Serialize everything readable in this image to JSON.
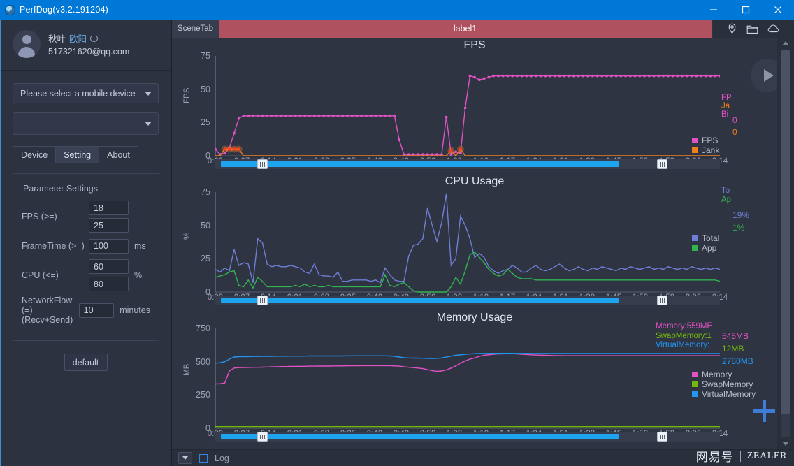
{
  "window": {
    "title": "PerfDog(v3.2.191204)",
    "app_icon": "globe-icon",
    "minimize": "minimize-icon",
    "maximize": "maximize-icon",
    "close": "close-icon"
  },
  "sidebar": {
    "profile": {
      "name_part1": "秋叶",
      "name_part2": "欧阳",
      "power_icon": "power-icon",
      "email": "517321620@qq.com"
    },
    "device_select": {
      "value": "Please select a mobile device",
      "caret": "chevron-down-icon"
    },
    "process_select": {
      "value": "",
      "caret": "chevron-down-icon"
    },
    "tabs": [
      {
        "label": "Device",
        "active": false
      },
      {
        "label": "Setting",
        "active": true
      },
      {
        "label": "About",
        "active": false
      }
    ],
    "settings": {
      "title": "Parameter Settings",
      "rows": [
        {
          "label": "FPS (>=)",
          "values": [
            "18",
            "25"
          ],
          "unit": ""
        },
        {
          "label": "FrameTime (>=)",
          "values": [
            "100"
          ],
          "unit": "ms"
        },
        {
          "label": "CPU (<=)",
          "values": [
            "60",
            "80"
          ],
          "unit": "%"
        },
        {
          "label": "NetworkFlow (=)\n(Recv+Send)",
          "values": [
            "10"
          ],
          "unit": "minutes"
        }
      ],
      "default_button": "default"
    }
  },
  "main": {
    "scene_tab": "SceneTab",
    "label_bar": "label1",
    "top_icons": [
      "location-pin-icon",
      "folder-icon",
      "cloud-icon"
    ],
    "play_button": "play-icon",
    "add_button": "plus-icon",
    "bottom": {
      "dropdown": "chevron-down-icon",
      "log_checkbox_label": "Log",
      "log_checked": false,
      "watermark_cn": "网易号",
      "watermark_en": "ZEALER"
    },
    "slider": {
      "left_handle": "range-handle-left",
      "right_handle": "range-handle-right"
    }
  },
  "chart_data": [
    {
      "type": "line",
      "title": "FPS",
      "ylabel": "FPS",
      "xlabel": "",
      "ylim": [
        0,
        75
      ],
      "yticks": [
        0,
        25,
        50,
        75
      ],
      "grid": false,
      "legend_position": "right",
      "x": [
        "0:00",
        "0:07",
        "0:14",
        "0:21",
        "0:28",
        "0:35",
        "0:42",
        "0:49",
        "0:56",
        "1:03",
        "1:10",
        "1:17",
        "1:24",
        "1:31",
        "1:38",
        "1:45",
        "1:52",
        "1:59",
        "2:06",
        "2:14"
      ],
      "cursor_labels": [
        "FP",
        "Ja",
        "Bi"
      ],
      "cursor_values": [
        "0",
        "0"
      ],
      "series": [
        {
          "name": "FPS",
          "color": "#e252c4",
          "values": [
            5,
            1,
            2,
            6,
            17,
            28,
            30,
            30,
            30,
            30,
            30,
            30,
            30,
            30,
            30,
            30,
            30,
            30,
            30,
            30,
            30,
            30,
            30,
            30,
            30,
            30,
            30,
            30,
            30,
            30,
            30,
            30,
            30,
            30,
            30,
            30,
            30,
            30,
            30,
            12,
            1,
            1,
            1,
            1,
            1,
            1,
            1,
            1,
            1,
            29,
            1,
            3,
            2,
            36,
            60,
            59,
            57,
            58,
            59,
            60,
            60,
            60,
            60,
            60,
            60,
            60,
            60,
            60,
            60,
            60,
            60,
            60,
            60,
            60,
            60,
            60,
            60,
            60,
            60,
            60,
            60,
            60,
            60,
            60,
            60,
            60,
            60,
            60,
            60,
            60,
            60,
            60,
            60,
            60,
            60,
            60,
            60,
            60,
            60,
            60,
            60,
            60,
            60,
            60,
            60,
            60,
            60,
            60
          ]
        },
        {
          "name": "Jank",
          "color": "#f07f1e",
          "values": [
            0,
            0,
            5,
            5,
            5,
            5,
            0,
            0,
            0,
            0,
            0,
            0,
            0,
            0,
            0,
            0,
            0,
            0,
            0,
            0,
            0,
            0,
            0,
            0,
            0,
            0,
            0,
            0,
            0,
            0,
            0,
            0,
            0,
            0,
            0,
            0,
            0,
            0,
            0,
            0,
            0,
            0,
            0,
            0,
            0,
            0,
            0,
            0,
            0,
            0,
            4,
            0,
            5,
            0,
            0,
            0,
            0,
            0,
            0,
            0,
            0,
            0,
            0,
            0,
            0,
            0,
            0,
            0,
            0,
            0,
            0,
            0,
            0,
            0,
            0,
            0,
            0,
            0,
            0,
            0,
            0,
            0,
            0,
            0,
            0,
            0,
            0,
            0,
            0,
            0,
            0,
            0,
            0,
            0,
            0,
            0,
            0,
            0,
            0,
            0,
            0,
            0,
            0,
            0,
            0,
            0,
            0,
            0
          ]
        }
      ],
      "legend": [
        {
          "label": "FPS",
          "color": "#e252c4"
        },
        {
          "label": "Jank",
          "color": "#f07f1e"
        }
      ]
    },
    {
      "type": "line",
      "title": "CPU Usage",
      "ylabel": "%",
      "xlabel": "",
      "ylim": [
        0,
        75
      ],
      "yticks": [
        0,
        25,
        50,
        75
      ],
      "grid": false,
      "legend_position": "right",
      "x": [
        "0:00",
        "0:07",
        "0:14",
        "0:21",
        "0:28",
        "0:35",
        "0:42",
        "0:49",
        "0:56",
        "1:03",
        "1:10",
        "1:17",
        "1:24",
        "1:31",
        "1:38",
        "1:45",
        "1:52",
        "1:59",
        "2:06",
        "2:14"
      ],
      "cursor_labels": [
        "To",
        "Ap"
      ],
      "cursor_values": [
        "19%",
        "1%"
      ],
      "series": [
        {
          "name": "Total",
          "color": "#6f7fd6",
          "values": [
            17,
            15,
            18,
            16,
            32,
            20,
            22,
            21,
            7,
            40,
            37,
            21,
            19,
            20,
            19,
            19,
            20,
            19,
            18,
            15,
            14,
            21,
            13,
            12,
            12,
            11,
            15,
            8,
            8,
            9,
            9,
            9,
            9,
            8,
            9,
            7,
            18,
            13,
            9,
            8,
            8,
            27,
            35,
            36,
            40,
            63,
            50,
            38,
            52,
            74,
            20,
            25,
            57,
            50,
            40,
            26,
            29,
            26,
            19,
            16,
            14,
            16,
            17,
            20,
            18,
            15,
            15,
            18,
            20,
            17,
            16,
            17,
            19,
            21,
            18,
            16,
            17,
            19,
            17,
            16,
            18,
            17,
            19,
            18,
            17,
            16,
            18,
            17,
            19,
            18,
            17,
            18,
            19,
            17,
            18,
            17,
            19,
            18,
            17,
            18,
            17,
            19,
            18,
            17,
            18,
            17,
            18,
            17
          ]
        },
        {
          "name": "App",
          "color": "#31b34f",
          "values": [
            11,
            12,
            13,
            15,
            16,
            5,
            4,
            9,
            3,
            11,
            8,
            4,
            4,
            4,
            4,
            4,
            4,
            5,
            4,
            6,
            4,
            5,
            4,
            4,
            5,
            4,
            4,
            4,
            4,
            4,
            4,
            4,
            4,
            4,
            4,
            4,
            13,
            5,
            4,
            6,
            7,
            4,
            1,
            0,
            0,
            0,
            0,
            0,
            0,
            0,
            4,
            11,
            6,
            16,
            28,
            30,
            26,
            22,
            17,
            14,
            12,
            13,
            17,
            14,
            11,
            10,
            10,
            10,
            9,
            9,
            9,
            9,
            9,
            9,
            9,
            9,
            9,
            9,
            9,
            9,
            9,
            9,
            9,
            9,
            9,
            9,
            9,
            9,
            9,
            9,
            9,
            9,
            9,
            9,
            9,
            9,
            9,
            9,
            9,
            9,
            9,
            9,
            9,
            9,
            9,
            9,
            9,
            8
          ]
        }
      ],
      "legend": [
        {
          "label": "Total",
          "color": "#6f7fd6"
        },
        {
          "label": "App",
          "color": "#31b34f"
        }
      ]
    },
    {
      "type": "line",
      "title": "Memory Usage",
      "ylabel": "MB",
      "xlabel": "",
      "ylim": [
        0,
        750
      ],
      "yticks": [
        0,
        250,
        500,
        750
      ],
      "grid": false,
      "legend_position": "right",
      "x": [
        "0:00",
        "0:07",
        "0:14",
        "0:21",
        "0:28",
        "0:35",
        "0:42",
        "0:49",
        "0:56",
        "1:03",
        "1:10",
        "1:17",
        "1:24",
        "1:31",
        "1:38",
        "1:45",
        "1:52",
        "1:59",
        "2:06",
        "2:14"
      ],
      "cursor_labels": [
        "Memory:559ME",
        "SwapMemory:1",
        "VirtualMemory:"
      ],
      "cursor_values": [
        "545MB",
        "12MB",
        "2780MB"
      ],
      "series": [
        {
          "name": "Memory",
          "color": "#e252c4",
          "values": [
            333,
            334,
            340,
            430,
            452,
            455,
            456,
            457,
            458,
            458,
            459,
            460,
            461,
            462,
            463,
            463,
            464,
            464,
            465,
            465,
            466,
            466,
            467,
            467,
            467,
            468,
            468,
            468,
            469,
            469,
            469,
            470,
            470,
            470,
            470,
            470,
            470,
            470,
            468,
            466,
            462,
            458,
            455,
            452,
            448,
            440,
            432,
            428,
            430,
            438,
            452,
            468,
            490,
            505,
            520,
            528,
            540,
            548,
            552,
            556,
            558,
            559,
            560,
            560,
            558,
            556,
            554,
            552,
            550,
            549,
            548,
            547,
            546,
            546,
            545,
            545,
            545,
            545,
            545,
            545,
            545,
            545,
            545,
            545,
            545,
            545,
            545,
            545,
            545,
            545,
            545,
            545,
            545,
            545,
            545,
            545,
            545,
            545,
            545,
            545,
            545,
            545,
            545,
            545,
            545,
            545,
            545,
            545
          ]
        },
        {
          "name": "SwapMemory",
          "color": "#73b80c",
          "values": [
            12,
            12,
            12,
            12,
            12,
            12,
            12,
            12,
            12,
            12,
            12,
            12,
            12,
            12,
            12,
            12,
            12,
            12,
            12,
            12,
            12,
            12,
            12,
            12,
            12,
            12,
            12,
            12,
            12,
            12,
            12,
            12,
            12,
            12,
            12,
            12,
            12,
            12,
            12,
            12,
            12,
            12,
            12,
            12,
            12,
            12,
            12,
            12,
            12,
            12,
            12,
            12,
            12,
            12,
            12,
            12,
            12,
            12,
            12,
            12,
            12,
            12,
            12,
            12,
            12,
            12,
            12,
            12,
            12,
            12,
            12,
            12,
            12,
            12,
            12,
            12,
            12,
            12,
            12,
            12,
            12,
            12,
            12,
            12,
            12,
            12,
            12,
            12,
            12,
            12,
            12,
            12,
            12,
            12,
            12,
            12,
            12,
            12,
            12,
            12,
            12,
            12,
            12,
            12,
            12,
            12,
            12,
            12
          ]
        },
        {
          "name": "VirtualMemory",
          "color": "#2196f3",
          "values": [
            489,
            492,
            500,
            520,
            535,
            537,
            538,
            538,
            539,
            539,
            540,
            540,
            540,
            541,
            541,
            541,
            542,
            542,
            542,
            542,
            543,
            543,
            543,
            543,
            543,
            543,
            543,
            543,
            544,
            544,
            544,
            544,
            544,
            544,
            544,
            544,
            544,
            543,
            540,
            535,
            530,
            528,
            527,
            527,
            526,
            525,
            524,
            525,
            528,
            535,
            542,
            548,
            552,
            556,
            558,
            560,
            561,
            562,
            562,
            563,
            563,
            563,
            563,
            563,
            562,
            562,
            562,
            561,
            561,
            561,
            561,
            561,
            561,
            561,
            561,
            561,
            561,
            561,
            561,
            561,
            561,
            561,
            561,
            561,
            561,
            561,
            561,
            561,
            561,
            561,
            561,
            561,
            561,
            561,
            561,
            561,
            561,
            561,
            561,
            561,
            561,
            561,
            561,
            561,
            561,
            561,
            561,
            561
          ]
        }
      ],
      "legend": [
        {
          "label": "Memory",
          "color": "#e252c4"
        },
        {
          "label": "SwapMemory",
          "color": "#73b80c"
        },
        {
          "label": "VirtualMemory",
          "color": "#2196f3"
        }
      ]
    }
  ]
}
